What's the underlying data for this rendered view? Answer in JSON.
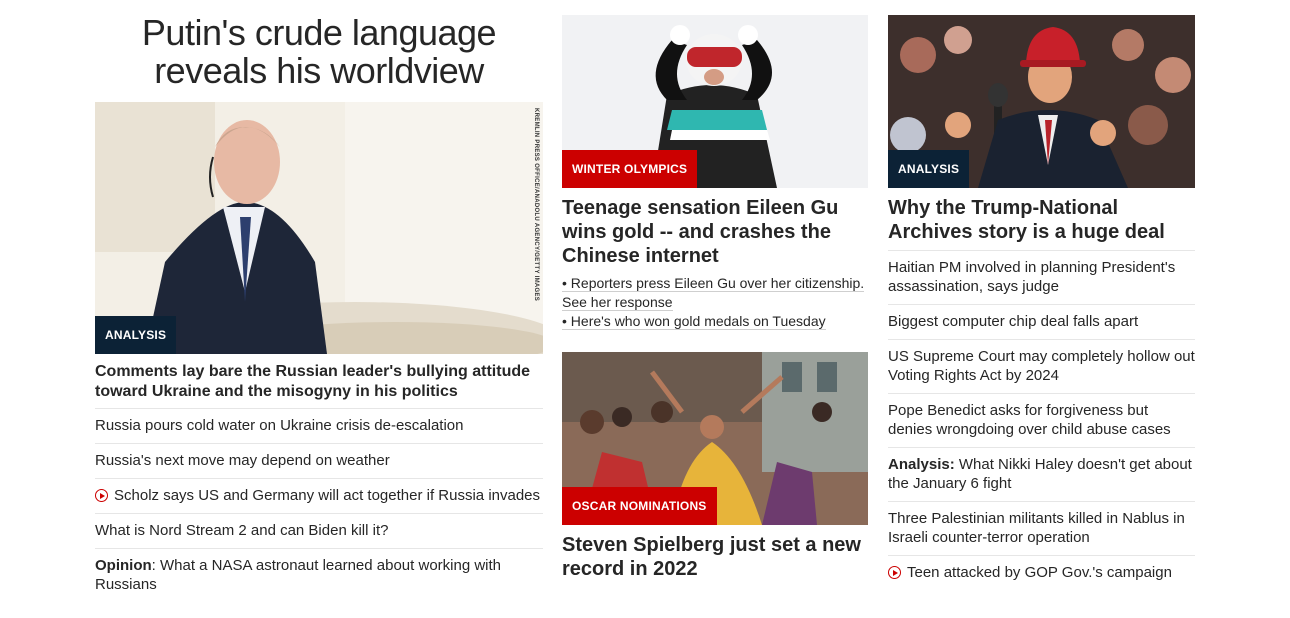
{
  "col1": {
    "title": "Putin's crude language reveals his worldview",
    "image_credit": "KREMLIN PRESS OFFICE/ANADOLU AGENCY/GETTY IMAGES",
    "label": "ANALYSIS",
    "headline": "Comments lay bare the Russian leader's bullying attitude toward Ukraine and the misogyny in his politics",
    "items": [
      {
        "text": "Russia pours cold water on Ukraine crisis de-escalation"
      },
      {
        "text": "Russia's next move may depend on weather"
      },
      {
        "text": "Scholz says US and Germany will act together if Russia invades",
        "icon": "play-icon"
      },
      {
        "text": "What is Nord Stream 2 and can Biden kill it?"
      },
      {
        "prefix": "Opinion",
        "text": ": What a NASA astronaut learned about working with Russians"
      }
    ]
  },
  "col2": {
    "story1": {
      "label": "WINTER OLYMPICS",
      "headline": "Teenage sensation Eileen Gu wins gold -- and crashes the Chinese internet",
      "bullets": [
        "• Reporters press Eileen Gu over her citizenship. See her response",
        "• Here's who won gold medals on Tuesday"
      ]
    },
    "story2": {
      "label": "OSCAR NOMINATIONS",
      "headline": "Steven Spielberg just set a new record in 2022"
    }
  },
  "col3": {
    "label": "ANALYSIS",
    "headline": "Why the Trump-National Archives story is a huge deal",
    "items": [
      {
        "text": "Haitian PM involved in planning President's assassination, says judge"
      },
      {
        "text": "Biggest computer chip deal falls apart"
      },
      {
        "text": "US Supreme Court may completely hollow out Voting Rights Act by 2024"
      },
      {
        "text": "Pope Benedict asks for forgiveness but denies wrongdoing over child abuse cases"
      },
      {
        "prefix": "Analysis:",
        "text": " What Nikki Haley doesn't get about the January 6 fight"
      },
      {
        "text": "Three Palestinian militants killed in Nablus in Israeli counter-terror operation"
      },
      {
        "text": "Teen attacked by GOP Gov.'s campaign",
        "icon": "play-icon"
      }
    ]
  },
  "colors": {
    "label_dark": "#0c2236",
    "label_red": "#cc0000",
    "text": "#262626"
  }
}
